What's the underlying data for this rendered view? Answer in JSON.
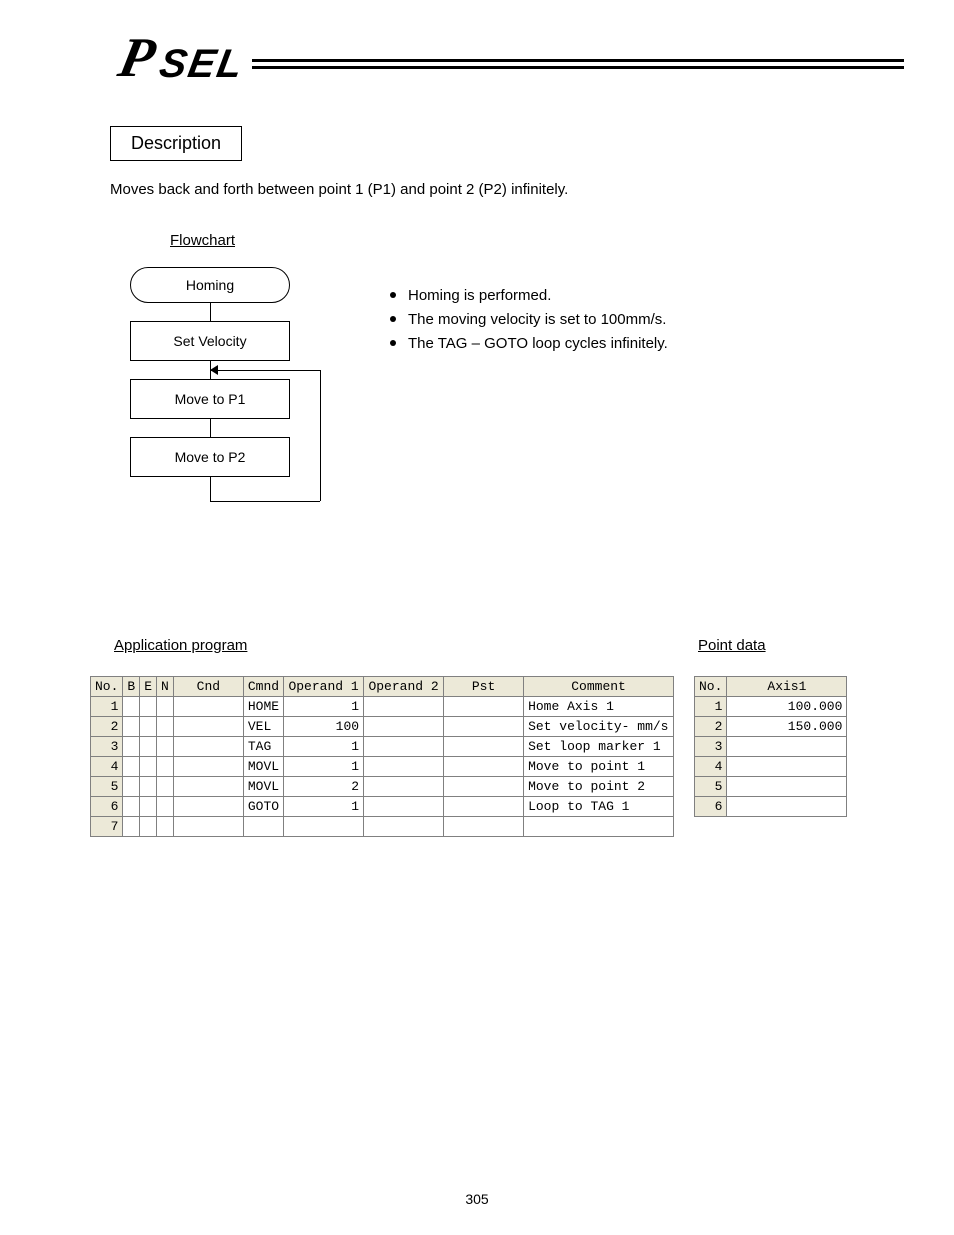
{
  "logo": {
    "p": "P",
    "sel": "SEL"
  },
  "section_title": "Description",
  "intro": "Moves back and forth between point 1 (P1) and point 2 (P2) infinitely.",
  "flowchart": {
    "heading": "Flowchart",
    "nodes": {
      "homing": "Homing",
      "set_velocity": "Set Velocity",
      "move_p1": "Move to P1",
      "move_p2": "Move to P2"
    }
  },
  "bullets": [
    "Homing is performed.",
    "The moving velocity is set to 100mm/s.",
    "The TAG – GOTO loop cycles infinitely."
  ],
  "app_heading": "Application program",
  "pt_heading": "Point data",
  "program_table": {
    "headers": {
      "no": "No.",
      "b": "B",
      "e": "E",
      "n": "N",
      "cnd": "Cnd",
      "cmnd": "Cmnd",
      "op1": "Operand 1",
      "op2": "Operand 2",
      "pst": "Pst",
      "comment": "Comment"
    },
    "rows": [
      {
        "no": "1",
        "cmnd": "HOME",
        "op1": "1",
        "op2": "",
        "comment": "Home Axis 1"
      },
      {
        "no": "2",
        "cmnd": "VEL",
        "op1": "100",
        "op2": "",
        "comment": "Set velocity- mm/s"
      },
      {
        "no": "3",
        "cmnd": "TAG",
        "op1": "1",
        "op2": "",
        "comment": "Set loop marker 1"
      },
      {
        "no": "4",
        "cmnd": "MOVL",
        "op1": "1",
        "op2": "",
        "comment": "Move to point 1"
      },
      {
        "no": "5",
        "cmnd": "MOVL",
        "op1": "2",
        "op2": "",
        "comment": "Move to point 2"
      },
      {
        "no": "6",
        "cmnd": "GOTO",
        "op1": "1",
        "op2": "",
        "comment": "Loop to TAG 1"
      },
      {
        "no": "7",
        "cmnd": "",
        "op1": "",
        "op2": "",
        "comment": ""
      }
    ]
  },
  "point_table": {
    "headers": {
      "no": "No.",
      "axis1": "Axis1"
    },
    "rows": [
      {
        "no": "1",
        "axis1": "100.000"
      },
      {
        "no": "2",
        "axis1": "150.000"
      },
      {
        "no": "3",
        "axis1": ""
      },
      {
        "no": "4",
        "axis1": ""
      },
      {
        "no": "5",
        "axis1": ""
      },
      {
        "no": "6",
        "axis1": ""
      }
    ]
  },
  "page_number": "305"
}
